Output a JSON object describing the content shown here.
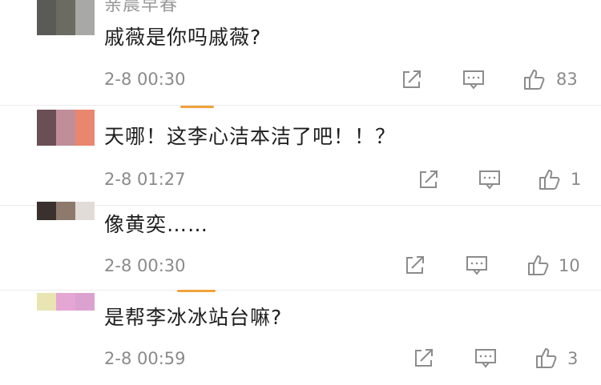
{
  "comments": [
    {
      "username": "亲晨早春",
      "text": "戚薇是你吗戚薇?",
      "time": "2-8 00:30",
      "likes": "83",
      "avatar_colors": [
        "#5a5a56",
        "#6b6b62",
        "#a8a8a4"
      ]
    },
    {
      "username": "",
      "text": "天哪！这李心洁本洁了吧！！？",
      "time": "2-8 01:27",
      "likes": "1",
      "avatar_colors": [
        "#6a4f55",
        "#c08e98",
        "#e9866e"
      ]
    },
    {
      "username": "",
      "text": "像黄奕……",
      "time": "2-8 00:30",
      "likes": "10",
      "avatar_colors": [
        "#3a302d",
        "#8d7a6d",
        "#e2dcd8"
      ]
    },
    {
      "username": "",
      "text": "是帮李冰冰站台嘛?",
      "time": "2-8 00:59",
      "likes": "3",
      "avatar_colors": [
        "#e9e5b2",
        "#e6a6d3",
        "#dba1cf"
      ]
    }
  ],
  "icons": {
    "share": "share-icon",
    "comment": "comment-icon",
    "like": "thumbs-up-icon"
  },
  "colors": {
    "text": "#1e1e1e",
    "meta": "#8a8a8a",
    "icon": "#8c8c8c",
    "accent": "#f1a23b",
    "divider": "#ececec"
  }
}
